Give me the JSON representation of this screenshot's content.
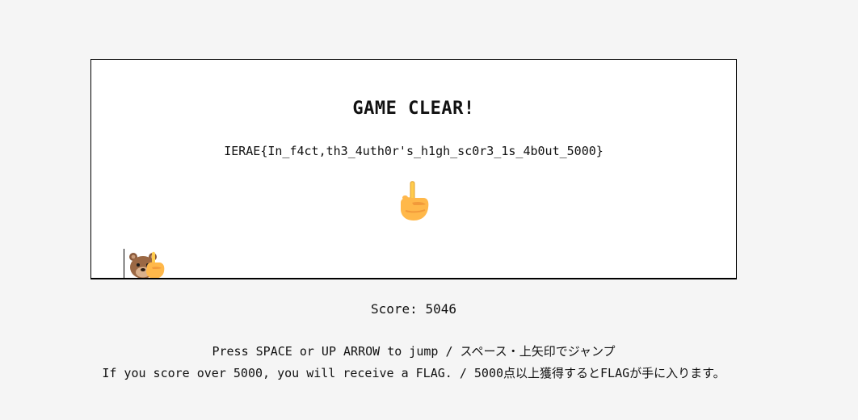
{
  "game": {
    "title": "GAME CLEAR!",
    "flag": "IERAE{In_f4ct,th3_4uth0r's_h1gh_sc0r3_1s_4b0ut_5000}",
    "hand_icon": "pointing-up-hand",
    "player_icon": "bear-with-hand"
  },
  "score": {
    "label": "Score: 5046",
    "value": 5046
  },
  "instructions": {
    "line1": "Press SPACE or UP ARROW to jump / スペース・上矢印でジャンプ",
    "line2": "If you score over 5000, you will receive a FLAG. / 5000点以上獲得するとFLAGが手に入ります。"
  }
}
